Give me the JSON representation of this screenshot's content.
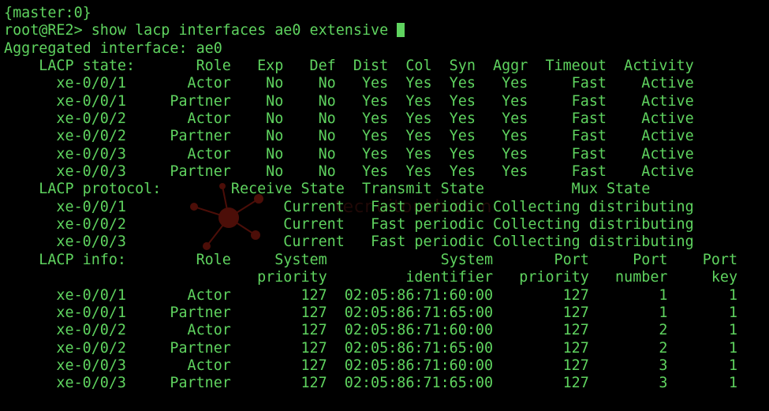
{
  "theme": {
    "foreground": "#5fd35f",
    "background": "#000000",
    "watermark_color": "#8b1a10"
  },
  "terminal": {
    "lines": [
      "{master:0}",
      "root@RE2> show lacp interfaces ae0 extensive ",
      "Aggregated interface: ae0",
      "    LACP state:       Role   Exp   Def  Dist  Col  Syn  Aggr  Timeout  Activity",
      "      xe-0/0/1       Actor    No    No   Yes  Yes  Yes   Yes     Fast    Active",
      "      xe-0/0/1     Partner    No    No   Yes  Yes  Yes   Yes     Fast    Active",
      "      xe-0/0/2       Actor    No    No   Yes  Yes  Yes   Yes     Fast    Active",
      "      xe-0/0/2     Partner    No    No   Yes  Yes  Yes   Yes     Fast    Active",
      "      xe-0/0/3       Actor    No    No   Yes  Yes  Yes   Yes     Fast    Active",
      "      xe-0/0/3     Partner    No    No   Yes  Yes  Yes   Yes     Fast    Active",
      "    LACP protocol:        Receive State  Transmit State          Mux State",
      "      xe-0/0/1                  Current   Fast periodic Collecting distributing",
      "      xe-0/0/2                  Current   Fast periodic Collecting distributing",
      "      xe-0/0/3                  Current   Fast periodic Collecting distributing",
      "    LACP info:        Role     System             System       Port     Port    Port",
      "                             priority         identifier   priority   number     key",
      "      xe-0/0/1       Actor        127  02:05:86:71:60:00        127        1       1",
      "      xe-0/0/1     Partner        127  02:05:86:71:65:00        127        1       1",
      "      xe-0/0/2       Actor        127  02:05:86:71:60:00        127        2       1",
      "      xe-0/0/2     Partner        127  02:05:86:71:65:00        127        2       1",
      "      xe-0/0/3       Actor        127  02:05:86:71:60:00        127        3       1",
      "      xe-0/0/3     Partner        127  02:05:86:71:65:00        127        3       1"
    ],
    "cursor_line_index": 1
  },
  "watermark": {
    "text": "tecnuitouch.com"
  }
}
